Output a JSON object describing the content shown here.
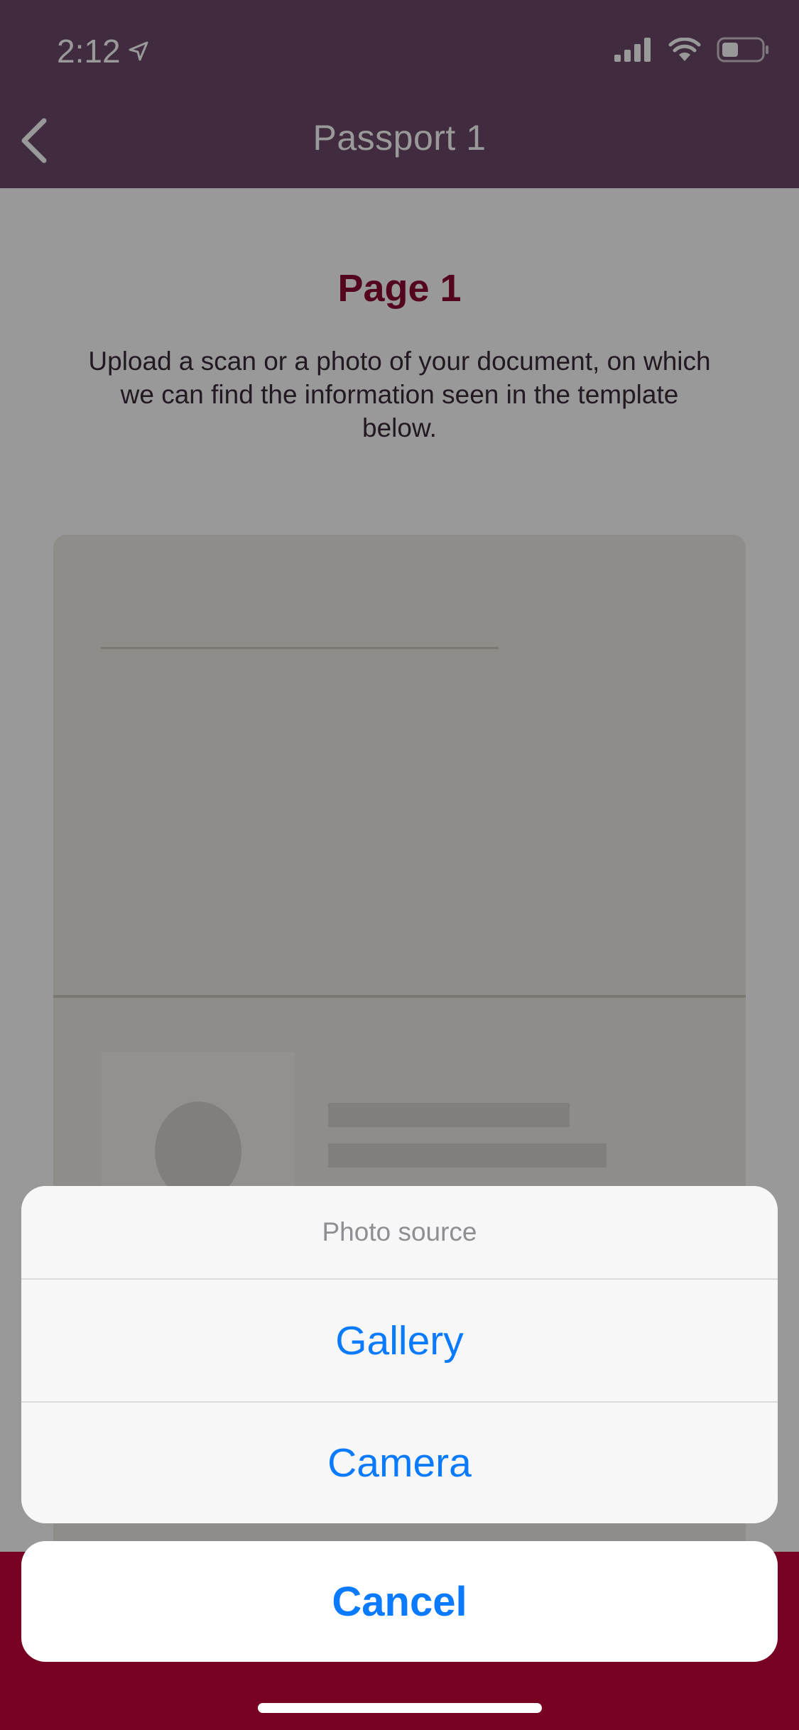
{
  "status_bar": {
    "time": "2:12",
    "location_icon": "location-arrow-icon",
    "signal_icon": "cellular-signal-icon",
    "wifi_icon": "wifi-icon",
    "battery_icon": "battery-icon"
  },
  "nav": {
    "back_icon": "chevron-left-icon",
    "title": "Passport 1"
  },
  "page": {
    "heading": "Page 1",
    "description": "Upload a scan or a photo of your document, on which we can find the information seen in the template below."
  },
  "action_sheet": {
    "title": "Photo source",
    "options": [
      "Gallery",
      "Camera"
    ],
    "cancel_label": "Cancel"
  },
  "colors": {
    "nav_bar": "#6b4a68",
    "heading": "#8c0a33",
    "bottom_band": "#c8003a",
    "action_blue": "#0a7aff"
  }
}
